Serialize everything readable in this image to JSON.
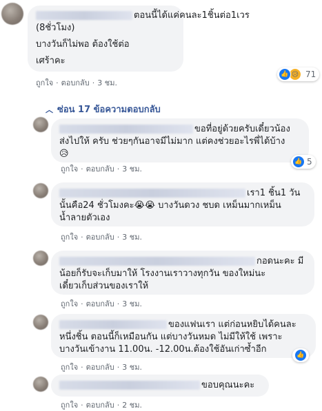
{
  "comments": [
    {
      "lines": [
        "ตอนนี้ได้แค่คนละ1ชิ้นต่อ1เวร",
        "(8ชั่วโมง)",
        "",
        "บางวันก็ไม่พอ ต้องใช้ต่อ",
        "",
        "เศร้าคะ"
      ],
      "like": "ถูกใจ",
      "reply": "ตอบกลับ",
      "time": "3 ชม.",
      "reaction_count": "71"
    },
    {
      "lines": [
        "ขอที่อยู่ด้วยครับเดี๋ยวน้อง",
        "ส่งไปให้ ครับ ช่วยๆกันอาจมีไม่มาก แต่คงช่วยอะไรพี่ได้บ้าง",
        "😥"
      ],
      "like": "ถูกใจ",
      "reply": "ตอบกลับ",
      "time": "3 ชม.",
      "reaction_count": "5"
    },
    {
      "lines": [
        "เรา1 ชิ้น1 วัน",
        "นั้นคือ24 ชั่วโมงคะ😭😭 บางวันดวง ชบด เหม็นมากเหม็น",
        "น้ำลายตัวเอง"
      ],
      "like": "ถูกใจ",
      "reply": "ตอบกลับ",
      "time": "3 ชม."
    },
    {
      "lines": [
        "กอดนะคะ มี",
        "น้อยก็รับจะเก็บมาให้ โรงงานเราวางทุกวัน ของใหม่นะ",
        "เดี๋ยวเก็บส่วนของเราให้"
      ],
      "like": "ถูกใจ",
      "reply": "ตอบกลับ",
      "time": "3 ชม."
    },
    {
      "lines": [
        "ของแฟนเรา แต่ก่อนหยิบได้คนละ",
        "หนึ่งชิ้น ตอนนี้ก็เหมือนกัน แต่บางวันหมด ไม่มีให้ใช้ เพราะ",
        "บางวันเข้างาน 11.00น. -12.00น.ต้องใช้อันเก่าซ้ำอีก"
      ],
      "like": "ถูกใจ",
      "reply": "ตอบกลับ",
      "time": "3 ชม."
    },
    {
      "lines": [
        "ขอบคุณนะคะ"
      ],
      "like": "ถูกใจ",
      "reply": "ตอบกลับ",
      "time": "2 ชม."
    }
  ],
  "replies_toggle": "ซ่อน 17 ข้อความตอบกลับ",
  "icons": {
    "like": "thumbs-up-icon",
    "sad": "sad-face-icon",
    "chevron": "chevron-up-icon"
  },
  "colors": {
    "like_blue": "#1877f2",
    "link_blue": "#385898",
    "bubble_bg": "#f2f3f5",
    "meta_gray": "#606770"
  }
}
